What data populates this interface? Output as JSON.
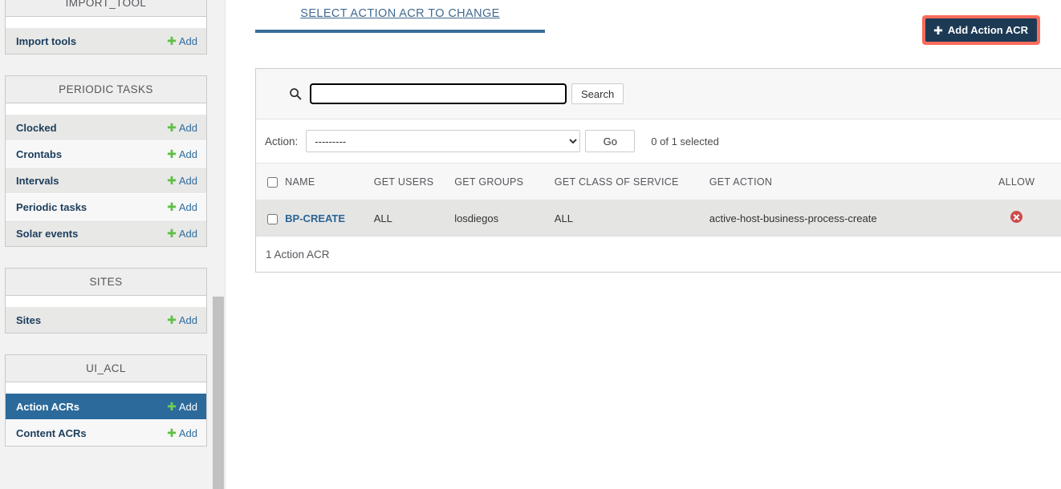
{
  "sidebar": {
    "modules": [
      {
        "caption": "IMPORT_TOOL",
        "items": [
          {
            "label": "Import tools",
            "add_label": "Add",
            "selected": false
          }
        ]
      },
      {
        "caption": "PERIODIC TASKS",
        "items": [
          {
            "label": "Clocked",
            "add_label": "Add",
            "selected": false
          },
          {
            "label": "Crontabs",
            "add_label": "Add",
            "selected": false
          },
          {
            "label": "Intervals",
            "add_label": "Add",
            "selected": false
          },
          {
            "label": "Periodic tasks",
            "add_label": "Add",
            "selected": false
          },
          {
            "label": "Solar events",
            "add_label": "Add",
            "selected": false
          }
        ]
      },
      {
        "caption": "SITES",
        "items": [
          {
            "label": "Sites",
            "add_label": "Add",
            "selected": false
          }
        ]
      },
      {
        "caption": "UI_ACL",
        "items": [
          {
            "label": "Action ACRs",
            "add_label": "Add",
            "selected": true
          },
          {
            "label": "Content ACRs",
            "add_label": "Add",
            "selected": false
          }
        ]
      }
    ],
    "plus_glyph": "✚",
    "scrollbar": {
      "name": "sidebar-scrollbar"
    }
  },
  "header": {
    "tab_label": "Select action ACR to change",
    "add_button_label": "Add Action ACR",
    "add_button_plus": "✚",
    "add_button_bg": "#1d3a55",
    "add_button_highlight": "#fb6b5b",
    "tab_color": "#41698f"
  },
  "search": {
    "icon": "search-icon",
    "value": "",
    "placeholder": "",
    "submit_label": "Search"
  },
  "actions": {
    "label": "Action:",
    "selected_option": "---------",
    "options": [
      "---------"
    ],
    "go_label": "Go",
    "counter": "0 of 1 selected"
  },
  "table": {
    "columns": [
      "NAME",
      "GET USERS",
      "GET GROUPS",
      "GET CLASS OF SERVICE",
      "GET ACTION",
      "ALLOW"
    ],
    "rows": [
      {
        "name": "BP-CREATE",
        "get_users": "ALL",
        "get_groups": "losdiegos",
        "get_class_of_service": "ALL",
        "get_action": "active-host-business-process-create",
        "allow_icon": "deny-circle-x-icon",
        "allow_color": "#cf4a4a",
        "checked": false
      }
    ],
    "select_all_checked": false
  },
  "paginator": {
    "summary": "1 Action ACR"
  }
}
